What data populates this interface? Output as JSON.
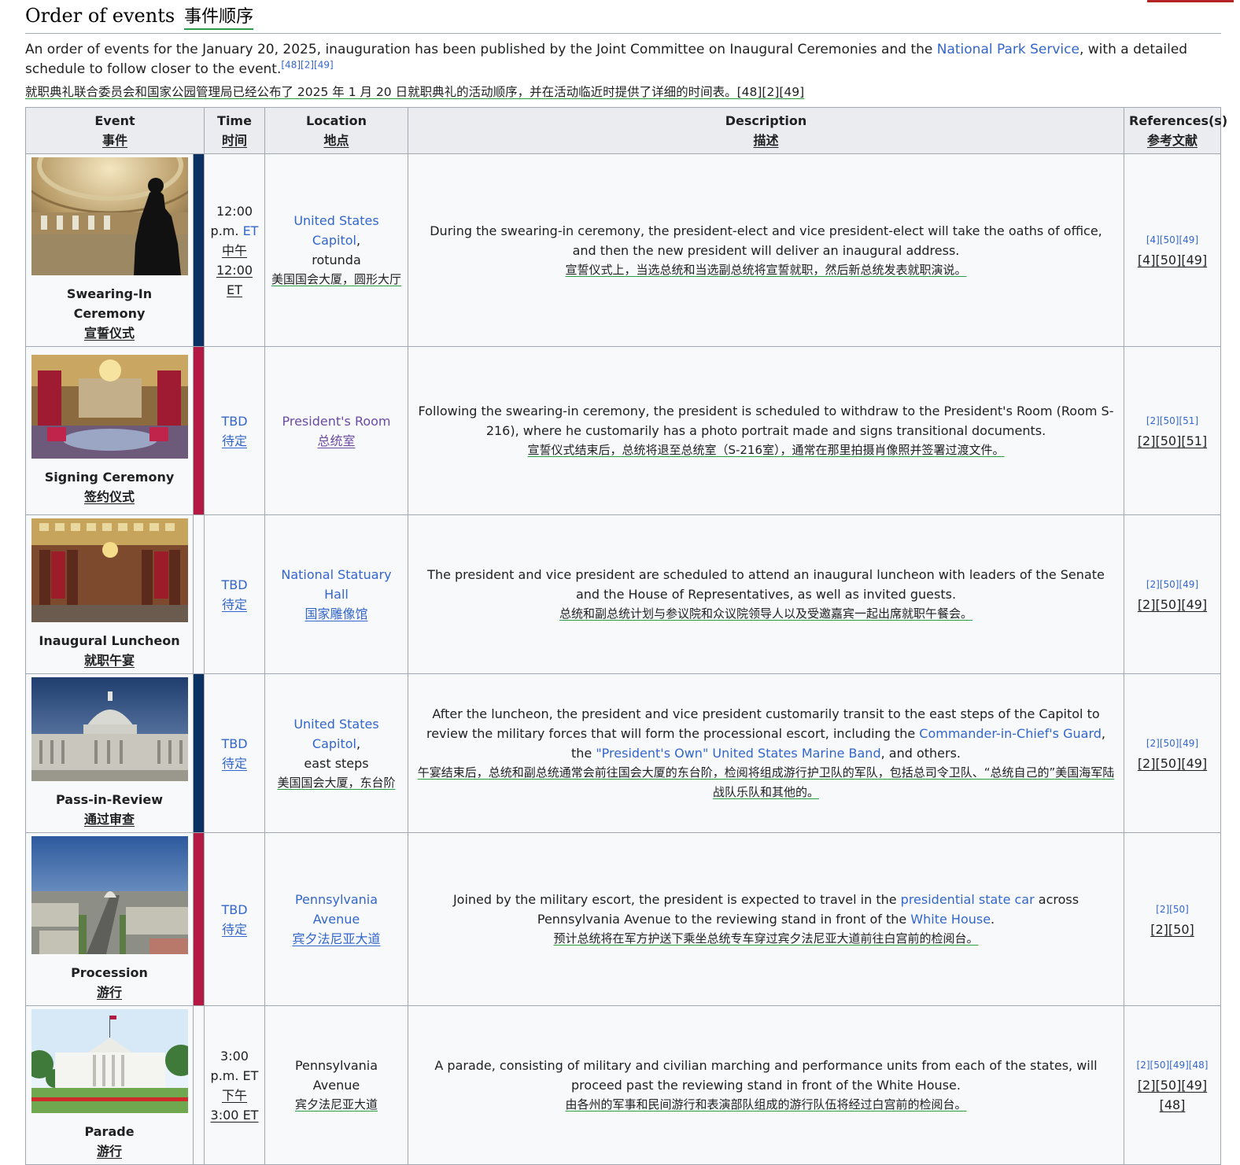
{
  "heading": {
    "en": "Order of events",
    "zh": "事件顺序"
  },
  "intro": {
    "text_before": "An order of events for the January 20, 2025, inauguration has been published by the Joint Committee on Inaugural Ceremonies and the ",
    "link": "National Park Service",
    "text_after": ", with a detailed schedule to follow closer to the event.",
    "refs": "[48][2][49]",
    "zh": "就职典礼联合委员会和国家公园管理局已经公布了 2025 年 1 月 20 日就职典礼的活动顺序，并在活动临近时提供了详细的时间表。[48][2][49]"
  },
  "columns": [
    {
      "en": "Event",
      "zh": "事件"
    },
    {
      "en": "Time",
      "zh": "时间"
    },
    {
      "en": "Location",
      "zh": "地点"
    },
    {
      "en": "Description",
      "zh": "描述"
    },
    {
      "en": "References(s)",
      "zh": "参考文献"
    }
  ],
  "colors": {
    "navy": "#0a3161",
    "red": "#b31942",
    "link": "#3366cc",
    "green_underline": "#2a9d4a"
  },
  "rows": [
    {
      "event": "Swearing-In Ceremony",
      "event_zh": "宣誓仪式",
      "time_a": "12:00",
      "time_b": "p.m.",
      "time_link": "ET",
      "time_zh1": "中午",
      "time_zh2": "12:00 ET",
      "loc_link": "United States Capitol",
      "loc_rest": "rotunda",
      "loc_zh": "美国国会大厦，圆形大厅",
      "desc": "During the swearing-in ceremony, the president-elect and vice president-elect will take the oaths of office, and then the new president will deliver an inaugural address.",
      "desc_zh": "宣誓仪式上，当选总统和当选副总统将宣誓就职，然后新总统发表就职演说。",
      "ref_small": "[4][50][49]",
      "ref_big": "[4][50][49]"
    },
    {
      "event": "Signing Ceremony",
      "event_zh": "签约仪式",
      "time": "TBD",
      "time_zh": "待定",
      "loc": "President's Room",
      "loc_zh": "总统室",
      "desc": "Following the swearing-in ceremony, the president is scheduled to withdraw to the President's Room (Room S-216), where he customarily has a photo portrait made and signs transitional documents.",
      "desc_zh": "宣誓仪式结束后，总统将退至总统室（S-216室），通常在那里拍摄肖像照并签署过渡文件。",
      "ref_small": "[2][50][51]",
      "ref_big": "[2][50][51]"
    },
    {
      "event": "Inaugural Luncheon",
      "event_zh": "就职午宴",
      "time": "TBD",
      "time_zh": "待定",
      "loc": "National Statuary Hall",
      "loc_zh": "国家雕像馆",
      "desc": "The president and vice president are scheduled to attend an inaugural luncheon with leaders of the Senate and the House of Representatives, as well as invited guests.",
      "desc_zh": "总统和副总统计划与参议院和众议院领导人以及受邀嘉宾一起出席就职午餐会。",
      "ref_small": "[2][50][49]",
      "ref_big": "[2][50][49]"
    },
    {
      "event": "Pass-in-Review",
      "event_zh": "通过审查",
      "time": "TBD",
      "time_zh": "待定",
      "loc_link": "United States Capitol",
      "loc_rest": "east steps",
      "loc_zh": "美国国会大厦，东台阶",
      "desc_a": "After the luncheon, the president and vice president customarily transit to the east steps of the Capitol to review the military forces that will form the processional escort, including the ",
      "desc_link1": "Commander-in-Chief's Guard",
      "desc_b": ", the ",
      "desc_link2": "\"President's Own\" United States Marine Band",
      "desc_c": ", and others.",
      "desc_zh": "午宴结束后，总统和副总统通常会前往国会大厦的东台阶，检阅将组成游行护卫队的军队，包括总司令卫队、“总统自己的”美国海军陆战队乐队和其他的。",
      "ref_small": "[2][50][49]",
      "ref_big": "[2][50][49]"
    },
    {
      "event": "Procession",
      "event_zh": "游行",
      "time": "TBD",
      "time_zh": "待定",
      "loc": "Pennsylvania Avenue",
      "loc_zh": "宾夕法尼亚大道",
      "desc_a": "Joined by the military escort, the president is expected to travel in the ",
      "desc_link1": "presidential state car",
      "desc_b": " across Pennsylvania Avenue to the reviewing stand in front of the ",
      "desc_link2": "White House",
      "desc_c": ".",
      "desc_zh": "预计总统将在军方护送下乘坐总统专车穿过宾夕法尼亚大道前往白宫前的检阅台。",
      "ref_small": "[2][50]",
      "ref_big": "[2][50]"
    },
    {
      "event": "Parade",
      "event_zh": "游行",
      "time_a": "3:00",
      "time_b": "p.m. ET",
      "time_zh1": "下午",
      "time_zh2": "3:00 ET",
      "loc": "Pennsylvania Avenue",
      "loc_zh": "宾夕法尼亚大道",
      "desc": "A parade, consisting of military and civilian marching and performance units from each of the states, will proceed past the reviewing stand in front of the White House.",
      "desc_zh": "由各州的军事和民间游行和表演部队组成的游行队伍将经过白宫前的检阅台。",
      "ref_small": "[2][50][49][48]",
      "ref_big1": "[2][50][49]",
      "ref_big2": "[48]"
    }
  ]
}
